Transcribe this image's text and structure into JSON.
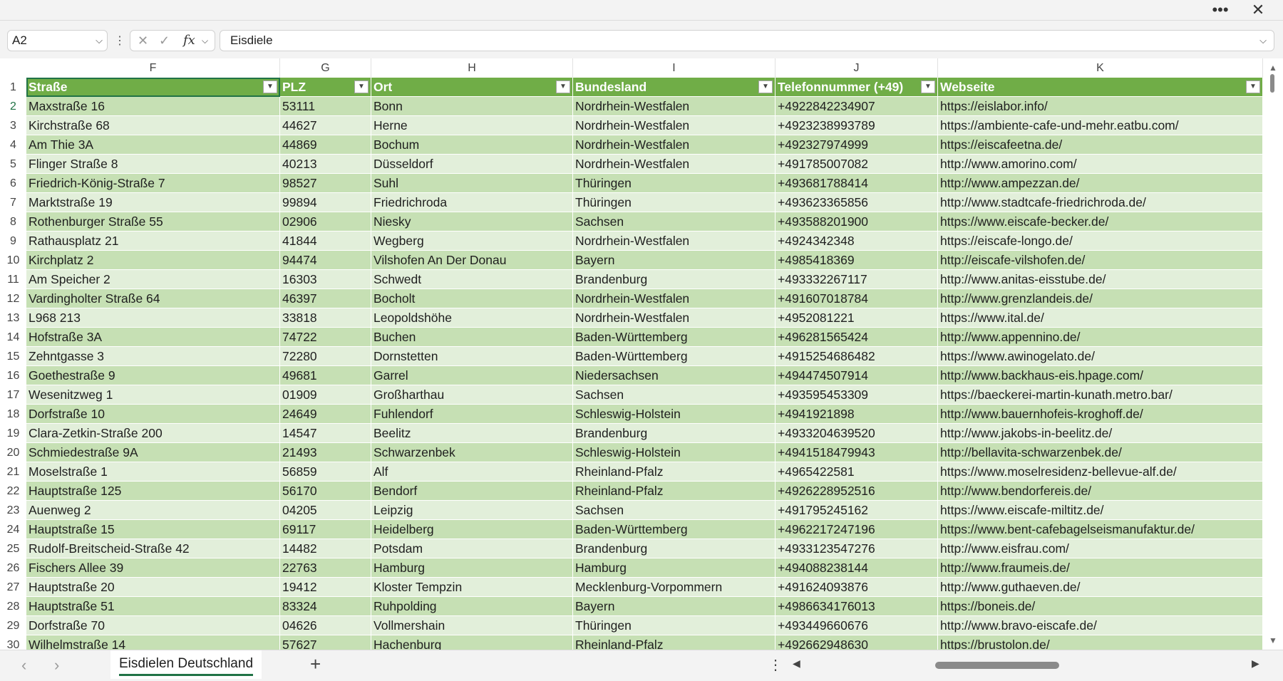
{
  "titlebar": {
    "more_icon": "ellipsis-icon",
    "close_icon": "close-icon",
    "more_label": "•••",
    "close_label": "✕"
  },
  "formula": {
    "namebox": "A2",
    "value": "Eisdiele",
    "cancel_icon": "✕",
    "enter_icon": "✓",
    "fx_label": "fx"
  },
  "columns": [
    "F",
    "G",
    "H",
    "I",
    "J",
    "K"
  ],
  "headers": [
    "Straße",
    "PLZ",
    "Ort",
    "Bundesland",
    "Telefonnummer (+49)",
    "Webseite"
  ],
  "rows": [
    {
      "n": "2",
      "c": [
        "Maxstraße 16",
        "53111",
        "Bonn",
        "Nordrhein-Westfalen",
        "+4922842234907",
        "https://eislabor.info/"
      ]
    },
    {
      "n": "3",
      "c": [
        "Kirchstraße 68",
        "44627",
        "Herne",
        "Nordrhein-Westfalen",
        "+4923238993789",
        "https://ambiente-cafe-und-mehr.eatbu.com/"
      ]
    },
    {
      "n": "4",
      "c": [
        "Am Thie 3A",
        "44869",
        "Bochum",
        "Nordrhein-Westfalen",
        "+492327974999",
        "https://eiscafeetna.de/"
      ]
    },
    {
      "n": "5",
      "c": [
        "Flinger Straße 8",
        "40213",
        "Düsseldorf",
        "Nordrhein-Westfalen",
        "+491785007082",
        "http://www.amorino.com/"
      ]
    },
    {
      "n": "6",
      "c": [
        "Friedrich-König-Straße 7",
        "98527",
        "Suhl",
        "Thüringen",
        "+493681788414",
        "http://www.ampezzan.de/"
      ]
    },
    {
      "n": "7",
      "c": [
        "Marktstraße 19",
        "99894",
        "Friedrichroda",
        "Thüringen",
        "+493623365856",
        "http://www.stadtcafe-friedrichroda.de/"
      ]
    },
    {
      "n": "8",
      "c": [
        "Rothenburger Straße 55",
        "02906",
        "Niesky",
        "Sachsen",
        "+493588201900",
        "https://www.eiscafe-becker.de/"
      ]
    },
    {
      "n": "9",
      "c": [
        "Rathausplatz 21",
        "41844",
        "Wegberg",
        "Nordrhein-Westfalen",
        "+4924342348",
        "https://eiscafe-longo.de/"
      ]
    },
    {
      "n": "10",
      "c": [
        "Kirchplatz 2",
        "94474",
        "Vilshofen An Der Donau",
        "Bayern",
        "+4985418369",
        "http://eiscafe-vilshofen.de/"
      ]
    },
    {
      "n": "11",
      "c": [
        "Am Speicher 2",
        "16303",
        "Schwedt",
        "Brandenburg",
        "+493332267117",
        "http://www.anitas-eisstube.de/"
      ]
    },
    {
      "n": "12",
      "c": [
        "Vardingholter Straße 64",
        "46397",
        "Bocholt",
        "Nordrhein-Westfalen",
        "+491607018784",
        "http://www.grenzlandeis.de/"
      ]
    },
    {
      "n": "13",
      "c": [
        "L968 213",
        "33818",
        "Leopoldshöhe",
        "Nordrhein-Westfalen",
        "+4952081221",
        "https://www.ital.de/"
      ]
    },
    {
      "n": "14",
      "c": [
        "Hofstraße 3A",
        "74722",
        "Buchen",
        "Baden-Württemberg",
        "+496281565424",
        "http://www.appennino.de/"
      ]
    },
    {
      "n": "15",
      "c": [
        "Zehntgasse 3",
        "72280",
        "Dornstetten",
        "Baden-Württemberg",
        "+4915254686482",
        "https://www.awinogelato.de/"
      ]
    },
    {
      "n": "16",
      "c": [
        "Goethestraße 9",
        "49681",
        "Garrel",
        "Niedersachsen",
        "+494474507914",
        "http://www.backhaus-eis.hpage.com/"
      ]
    },
    {
      "n": "17",
      "c": [
        "Wesenitzweg 1",
        "01909",
        "Großharthau",
        "Sachsen",
        "+493595453309",
        "https://baeckerei-martin-kunath.metro.bar/"
      ]
    },
    {
      "n": "18",
      "c": [
        "Dorfstraße 10",
        "24649",
        "Fuhlendorf",
        "Schleswig-Holstein",
        "+4941921898",
        "http://www.bauernhofeis-kroghoff.de/"
      ]
    },
    {
      "n": "19",
      "c": [
        "Clara-Zetkin-Straße 200",
        "14547",
        "Beelitz",
        "Brandenburg",
        "+4933204639520",
        "http://www.jakobs-in-beelitz.de/"
      ]
    },
    {
      "n": "20",
      "c": [
        "Schmiedestraße 9A",
        "21493",
        "Schwarzenbek",
        "Schleswig-Holstein",
        "+4941518479943",
        "http://bellavita-schwarzenbek.de/"
      ]
    },
    {
      "n": "21",
      "c": [
        "Moselstraße 1",
        "56859",
        "Alf",
        "Rheinland-Pfalz",
        "+4965422581",
        "https://www.moselresidenz-bellevue-alf.de/"
      ]
    },
    {
      "n": "22",
      "c": [
        "Hauptstraße 125",
        "56170",
        "Bendorf",
        "Rheinland-Pfalz",
        "+4926228952516",
        "http://www.bendorfereis.de/"
      ]
    },
    {
      "n": "23",
      "c": [
        "Auenweg 2",
        "04205",
        "Leipzig",
        "Sachsen",
        "+491795245162",
        "https://www.eiscafe-miltitz.de/"
      ]
    },
    {
      "n": "24",
      "c": [
        "Hauptstraße 15",
        "69117",
        "Heidelberg",
        "Baden-Württemberg",
        "+4962217247196",
        "https://www.bent-cafebagelseismanufaktur.de/"
      ]
    },
    {
      "n": "25",
      "c": [
        "Rudolf-Breitscheid-Straße 42",
        "14482",
        "Potsdam",
        "Brandenburg",
        "+4933123547276",
        "http://www.eisfrau.com/"
      ]
    },
    {
      "n": "26",
      "c": [
        "Fischers Allee 39",
        "22763",
        "Hamburg",
        "Hamburg",
        "+494088238144",
        "http://www.fraumeis.de/"
      ]
    },
    {
      "n": "27",
      "c": [
        "Hauptstraße 20",
        "19412",
        "Kloster Tempzin",
        "Mecklenburg-Vorpommern",
        "+491624093876",
        "http://www.guthaeven.de/"
      ]
    },
    {
      "n": "28",
      "c": [
        "Hauptstraße 51",
        "83324",
        "Ruhpolding",
        "Bayern",
        "+4986634176013",
        "https://boneis.de/"
      ]
    },
    {
      "n": "29",
      "c": [
        "Dorfstraße 70",
        "04626",
        "Vollmershain",
        "Thüringen",
        "+493449660676",
        "http://www.bravo-eiscafe.de/"
      ]
    },
    {
      "n": "30",
      "c": [
        "Wilhelmstraße 14",
        "57627",
        "Hachenburg",
        "Rheinland-Pfalz",
        "+492662948630",
        "https://brustolon.de/"
      ]
    }
  ],
  "sheet_tab": "Eisdielen Deutschland",
  "colors": {
    "header_green": "#70ad47",
    "band_light": "#e2efda",
    "band_dark": "#c6e0b4",
    "selection": "#217346"
  }
}
